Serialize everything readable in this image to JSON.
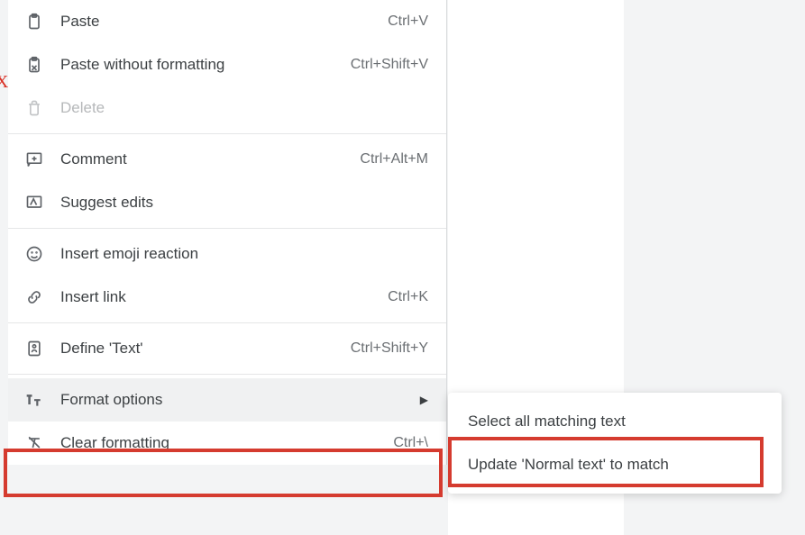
{
  "menu": {
    "paste": {
      "label": "Paste",
      "shortcut": "Ctrl+V"
    },
    "paste_without": {
      "label": "Paste without formatting",
      "shortcut": "Ctrl+Shift+V"
    },
    "delete": {
      "label": "Delete",
      "shortcut": ""
    },
    "comment": {
      "label": "Comment",
      "shortcut": "Ctrl+Alt+M"
    },
    "suggest_edits": {
      "label": "Suggest edits",
      "shortcut": ""
    },
    "emoji": {
      "label": "Insert emoji reaction",
      "shortcut": ""
    },
    "insert_link": {
      "label": "Insert link",
      "shortcut": "Ctrl+K"
    },
    "define": {
      "label": "Define 'Text'",
      "shortcut": "Ctrl+Shift+Y"
    },
    "format_options": {
      "label": "Format options",
      "shortcut": "",
      "arrow": "▶"
    },
    "clear_formatting": {
      "label": "Clear formatting",
      "shortcut": "Ctrl+\\"
    }
  },
  "submenu": {
    "select_matching": {
      "label": "Select all matching text"
    },
    "update_normal": {
      "label": "Update 'Normal text' to match"
    }
  },
  "fragments": {
    "x": "X"
  },
  "colors": {
    "highlight_border": "#d53b2f"
  }
}
